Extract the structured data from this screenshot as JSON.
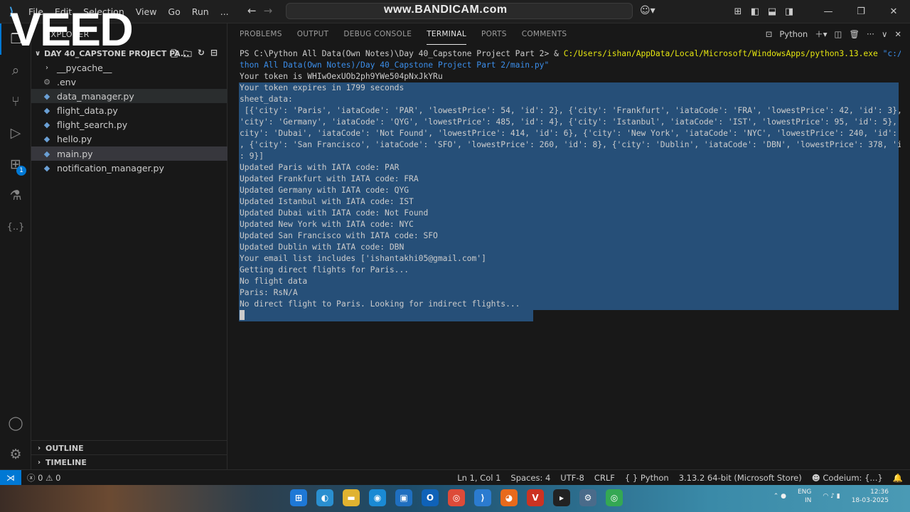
{
  "watermarks": {
    "veed": "VEED",
    "bandicam": "www.BANDICAM.com"
  },
  "menu": [
    "File",
    "Edit",
    "Selection",
    "View",
    "Go",
    "Run",
    "..."
  ],
  "explorer": {
    "header": "EXPLORER",
    "folder": "DAY 40_CAPSTONE PROJECT PA...",
    "items": [
      {
        "label": "__pycache__",
        "kind": "folder"
      },
      {
        "label": ".env",
        "kind": "gear"
      },
      {
        "label": "data_manager.py",
        "kind": "py"
      },
      {
        "label": "flight_data.py",
        "kind": "py"
      },
      {
        "label": "flight_search.py",
        "kind": "py"
      },
      {
        "label": "hello.py",
        "kind": "py"
      },
      {
        "label": "main.py",
        "kind": "py"
      },
      {
        "label": "notification_manager.py",
        "kind": "py"
      }
    ],
    "outline": "OUTLINE",
    "timeline": "TIMELINE"
  },
  "panel": {
    "tabs": [
      "PROBLEMS",
      "OUTPUT",
      "DEBUG CONSOLE",
      "TERMINAL",
      "PORTS",
      "COMMENTS"
    ],
    "active_tab": "TERMINAL",
    "profile": "Python"
  },
  "terminal": {
    "prompt": "PS C:\\Python All Data(Own Notes)\\Day 40_Capstone Project Part 2> & ",
    "cmd_exe": "C:/Users/ishan/AppData/Local/Microsoft/WindowsApps/python3.13.exe",
    "cmd_arg1": " \"c:/Py",
    "cmd_arg2": "thon All Data(Own Notes)/Day 40_Capstone Project Part 2/main.py\"",
    "lines": [
      "Your token is WHIwOexUOb2ph9YWe504pNxJkYRu",
      "Your token expires in 1799 seconds",
      "sheet_data:",
      " [{'city': 'Paris', 'iataCode': 'PAR', 'lowestPrice': 54, 'id': 2}, {'city': 'Frankfurt', 'iataCode': 'FRA', 'lowestPrice': 42, 'id': 3}, {",
      "'city': 'Germany', 'iataCode': 'QYG', 'lowestPrice': 485, 'id': 4}, {'city': 'Istanbul', 'iataCode': 'IST', 'lowestPrice': 95, 'id': 5}, {'",
      "city': 'Dubai', 'iataCode': 'Not Found', 'lowestPrice': 414, 'id': 6}, {'city': 'New York', 'iataCode': 'NYC', 'lowestPrice': 240, 'id': 7}",
      ", {'city': 'San Francisco', 'iataCode': 'SFO', 'lowestPrice': 260, 'id': 8}, {'city': 'Dublin', 'iataCode': 'DBN', 'lowestPrice': 378, 'id'",
      ": 9}]",
      "Updated Paris with IATA code: PAR",
      "Updated Frankfurt with IATA code: FRA",
      "Updated Germany with IATA code: QYG",
      "Updated Istanbul with IATA code: IST",
      "Updated Dubai with IATA code: Not Found",
      "Updated New York with IATA code: NYC",
      "Updated San Francisco with IATA code: SFO",
      "Updated Dublin with IATA code: DBN",
      "Your email list includes ['ishantakhi05@gmail.com']",
      "Getting direct flights for Paris...",
      "No flight data",
      "Paris: RsN/A",
      "No direct flight to Paris. Looking for indirect flights..."
    ]
  },
  "status": {
    "errors": "0",
    "warnings": "0",
    "position": "Ln 1, Col 1",
    "spaces": "Spaces: 4",
    "encoding": "UTF-8",
    "eol": "CRLF",
    "language": "Python",
    "interpreter": "3.13.2 64-bit (Microsoft Store)",
    "codeium": "Codeium: {...}"
  },
  "tray": {
    "lang1": "ENG",
    "lang2": "IN",
    "time": "12:36",
    "date": "18-03-2025"
  }
}
